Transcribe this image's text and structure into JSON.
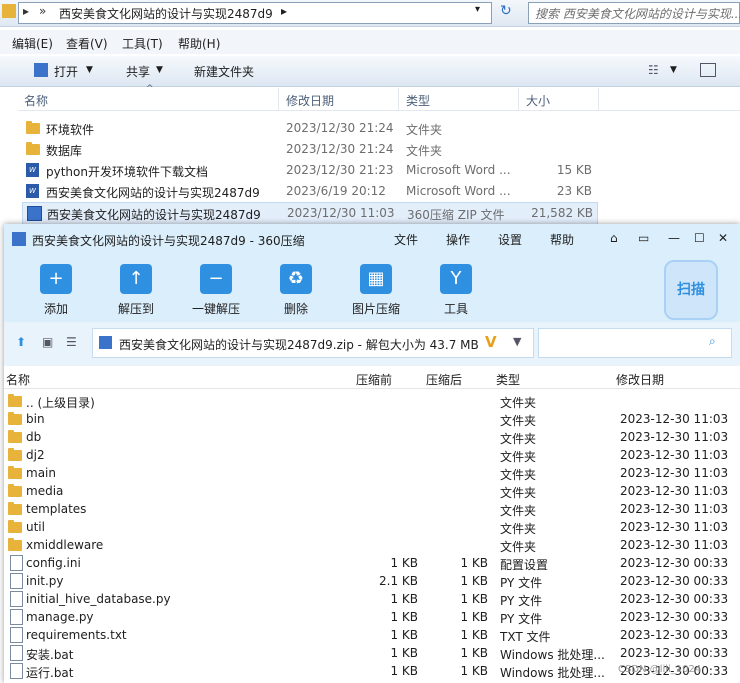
{
  "explorer": {
    "address": "西安美食文化网站的设计与实现2487d9",
    "search_placeholder": "搜索 西安美食文化网站的设计与实现...",
    "menu": [
      "编辑(E)",
      "查看(V)",
      "工具(T)",
      "帮助(H)"
    ],
    "commands": {
      "open": "打开",
      "share": "共享",
      "new_folder": "新建文件夹"
    },
    "columns": {
      "name": "名称",
      "date": "修改日期",
      "type": "类型",
      "size": "大小"
    },
    "files": [
      {
        "name": "环境软件",
        "date": "2023/12/30 21:24",
        "type": "文件夹",
        "size": "",
        "icon": "folder"
      },
      {
        "name": "数据库",
        "date": "2023/12/30 21:24",
        "type": "文件夹",
        "size": "",
        "icon": "folder"
      },
      {
        "name": "python开发环境软件下载文档",
        "date": "2023/12/30 21:23",
        "type": "Microsoft Word ...",
        "size": "15 KB",
        "icon": "word-doc"
      },
      {
        "name": "西安美食文化网站的设计与实现2487d9",
        "date": "2023/6/19 20:12",
        "type": "Microsoft Word ...",
        "size": "23 KB",
        "icon": "word-doc"
      },
      {
        "name": "西安美食文化网站的设计与实现2487d9",
        "date": "2023/12/30 11:03",
        "type": "360压缩 ZIP 文件",
        "size": "21,582 KB",
        "icon": "zip"
      }
    ]
  },
  "zipwin": {
    "title": "西安美食文化网站的设计与实现2487d9 - 360压缩",
    "menu": [
      "文件",
      "操作",
      "设置",
      "帮助"
    ],
    "toolbar": [
      "添加",
      "解压到",
      "一键解压",
      "删除",
      "图片压缩",
      "工具"
    ],
    "scan_label": "扫描",
    "path_text": "西安美食文化网站的设计与实现2487d9.zip - 解包大小为 43.7 MB",
    "columns": {
      "name": "名称",
      "packed": "压缩前",
      "unpacked": "压缩后",
      "type": "类型",
      "date": "修改日期"
    },
    "rows": [
      {
        "name": ".. (上级目录)",
        "packed": "",
        "unpacked": "",
        "type": "文件夹",
        "date": "",
        "icon": "folder"
      },
      {
        "name": "bin",
        "packed": "",
        "unpacked": "",
        "type": "文件夹",
        "date": "2023-12-30 11:03",
        "icon": "folder"
      },
      {
        "name": "db",
        "packed": "",
        "unpacked": "",
        "type": "文件夹",
        "date": "2023-12-30 11:03",
        "icon": "folder"
      },
      {
        "name": "dj2",
        "packed": "",
        "unpacked": "",
        "type": "文件夹",
        "date": "2023-12-30 11:03",
        "icon": "folder"
      },
      {
        "name": "main",
        "packed": "",
        "unpacked": "",
        "type": "文件夹",
        "date": "2023-12-30 11:03",
        "icon": "folder"
      },
      {
        "name": "media",
        "packed": "",
        "unpacked": "",
        "type": "文件夹",
        "date": "2023-12-30 11:03",
        "icon": "folder"
      },
      {
        "name": "templates",
        "packed": "",
        "unpacked": "",
        "type": "文件夹",
        "date": "2023-12-30 11:03",
        "icon": "folder"
      },
      {
        "name": "util",
        "packed": "",
        "unpacked": "",
        "type": "文件夹",
        "date": "2023-12-30 11:03",
        "icon": "folder"
      },
      {
        "name": "xmiddleware",
        "packed": "",
        "unpacked": "",
        "type": "文件夹",
        "date": "2023-12-30 11:03",
        "icon": "folder"
      },
      {
        "name": "config.ini",
        "packed": "1 KB",
        "unpacked": "1 KB",
        "type": "配置设置",
        "date": "2023-12-30 00:33",
        "icon": "file"
      },
      {
        "name": "init.py",
        "packed": "2.1 KB",
        "unpacked": "1 KB",
        "type": "PY 文件",
        "date": "2023-12-30 00:33",
        "icon": "file"
      },
      {
        "name": "initial_hive_database.py",
        "packed": "1 KB",
        "unpacked": "1 KB",
        "type": "PY 文件",
        "date": "2023-12-30 00:33",
        "icon": "file"
      },
      {
        "name": "manage.py",
        "packed": "1 KB",
        "unpacked": "1 KB",
        "type": "PY 文件",
        "date": "2023-12-30 00:33",
        "icon": "file"
      },
      {
        "name": "requirements.txt",
        "packed": "1 KB",
        "unpacked": "1 KB",
        "type": "TXT 文件",
        "date": "2023-12-30 00:33",
        "icon": "file"
      },
      {
        "name": "安装.bat",
        "packed": "1 KB",
        "unpacked": "1 KB",
        "type": "Windows 批处理...",
        "date": "2023-12-30 00:33",
        "icon": "file"
      },
      {
        "name": "运行.bat",
        "packed": "1 KB",
        "unpacked": "1 KB",
        "type": "Windows 批处理...",
        "date": "2023-12-30 00:33",
        "icon": "file"
      }
    ],
    "watermark": "CSDN @lili_1024"
  },
  "colors": {
    "accent": "#2f8fe0",
    "titlebar": "#dbeefb",
    "selection": "#e3eefb"
  }
}
